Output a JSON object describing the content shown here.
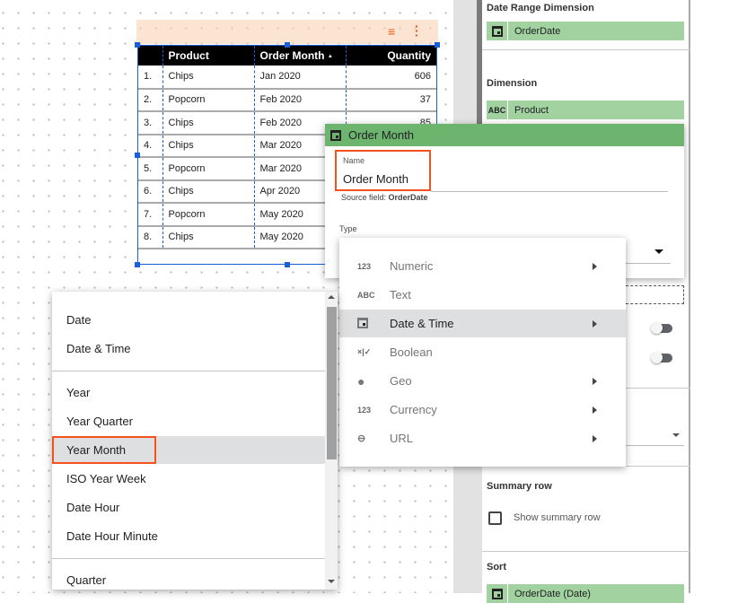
{
  "colors": {
    "accent_green": "#6db46f",
    "chip_green": "#a2d29f",
    "highlight_red": "#f4511e",
    "selection_blue": "#1a5fd6"
  },
  "chart_toolbar": {
    "icons": [
      "filter-icon",
      "more-vert-icon"
    ]
  },
  "table": {
    "columns": [
      "",
      "Product",
      "Order Month",
      "Quantity"
    ],
    "sort_indicator": "▲",
    "rows": [
      [
        "1.",
        "Chips",
        "Jan 2020",
        "606"
      ],
      [
        "2.",
        "Popcorn",
        "Feb 2020",
        "37"
      ],
      [
        "3.",
        "Chips",
        "Feb 2020",
        "85"
      ],
      [
        "4.",
        "Chips",
        "Mar 2020",
        ""
      ],
      [
        "5.",
        "Popcorn",
        "Mar 2020",
        ""
      ],
      [
        "6.",
        "Chips",
        "Apr 2020",
        ""
      ],
      [
        "7.",
        "Popcorn",
        "May 2020",
        ""
      ],
      [
        "8.",
        "Chips",
        "May 2020",
        ""
      ]
    ]
  },
  "field_editor": {
    "title": "Order Month",
    "name_label": "Name",
    "name_value": "Order Month",
    "source_prefix": "Source field: ",
    "source_field": "OrderDate",
    "type_label": "Type"
  },
  "type_menu": {
    "items": [
      {
        "icon": "123",
        "label": "Numeric",
        "submenu": true
      },
      {
        "icon": "ABC",
        "label": "Text",
        "submenu": false
      },
      {
        "icon": "calendar",
        "label": "Date & Time",
        "submenu": true,
        "selected": true
      },
      {
        "icon": "×|✓",
        "label": "Boolean",
        "submenu": false
      },
      {
        "icon": "globe",
        "label": "Geo",
        "submenu": true
      },
      {
        "icon": "123",
        "label": "Currency",
        "submenu": true
      },
      {
        "icon": "link",
        "label": "URL",
        "submenu": true
      }
    ]
  },
  "date_menu": {
    "items": [
      "Date",
      "Date & Time",
      "Year",
      "Year Quarter",
      "Year Month",
      "ISO Year Week",
      "Date Hour",
      "Date Hour Minute",
      "Quarter"
    ],
    "selected": "Year Month"
  },
  "panel": {
    "date_range_label": "Date Range Dimension",
    "date_range_value": "OrderDate",
    "dimension_label": "Dimension",
    "dimension_icon": "ABC",
    "dimension_value": "Product",
    "summary_label": "Summary row",
    "summary_checkbox": "Show summary row",
    "summary_checked": false,
    "sort_label": "Sort",
    "sort_value": "OrderDate (Date)"
  }
}
